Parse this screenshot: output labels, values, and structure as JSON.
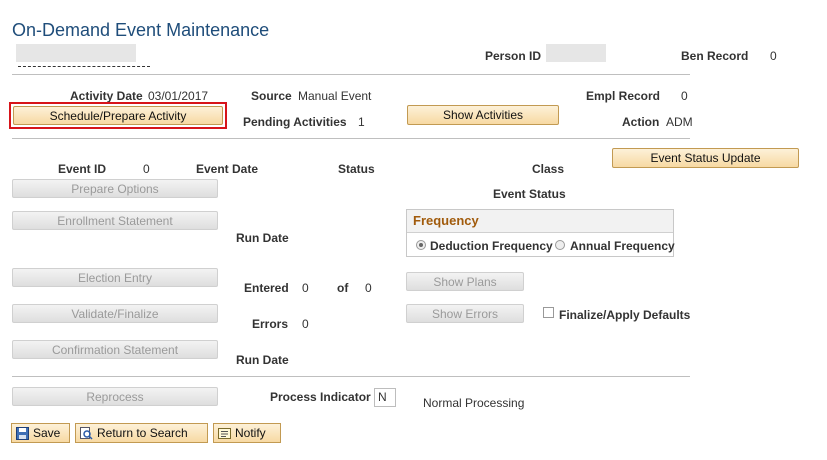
{
  "page": {
    "title": "On-Demand Event Maintenance"
  },
  "header": {
    "person_id_label": "Person ID",
    "ben_record_label": "Ben Record",
    "ben_record_value": "0"
  },
  "activity": {
    "activity_date_label": "Activity Date",
    "activity_date_value": "03/01/2017",
    "source_label": "Source",
    "source_value": "Manual Event",
    "empl_record_label": "Empl Record",
    "empl_record_value": "0",
    "pending_label": "Pending Activities",
    "pending_value": "1",
    "action_label": "Action",
    "action_value": "ADM",
    "schedule_button": "Schedule/Prepare Activity",
    "show_activities_button": "Show Activities"
  },
  "event": {
    "event_id_label": "Event ID",
    "event_id_value": "0",
    "event_date_label": "Event Date",
    "status_label": "Status",
    "class_label": "Class",
    "event_status_update_button": "Event Status Update",
    "event_status_label": "Event Status"
  },
  "buttons": {
    "prepare_options": "Prepare Options",
    "enrollment_statement": "Enrollment Statement",
    "election_entry": "Election Entry",
    "validate_finalize": "Validate/Finalize",
    "confirmation_statement": "Confirmation Statement",
    "reprocess": "Reprocess",
    "show_plans": "Show Plans",
    "show_errors": "Show Errors"
  },
  "frequency": {
    "header": "Frequency",
    "deduction_label": "Deduction Frequency",
    "annual_label": "Annual Frequency",
    "selected": "deduction"
  },
  "details": {
    "run_date_label": "Run Date",
    "entered_label": "Entered",
    "entered_value": "0",
    "of_label": "of",
    "of_value": "0",
    "errors_label": "Errors",
    "errors_value": "0",
    "run_date2_label": "Run Date",
    "finalize_label": "Finalize/Apply Defaults",
    "process_indicator_label": "Process Indicator",
    "process_indicator_value": "N",
    "process_text": "Normal Processing"
  },
  "toolbar": {
    "save": "Save",
    "return_to_search": "Return to Search",
    "notify": "Notify"
  },
  "colors": {
    "title": "#1f4d7a",
    "button_border": "#c29a52",
    "highlight": "#d7141a",
    "frequency_header": "#a15b0c"
  }
}
